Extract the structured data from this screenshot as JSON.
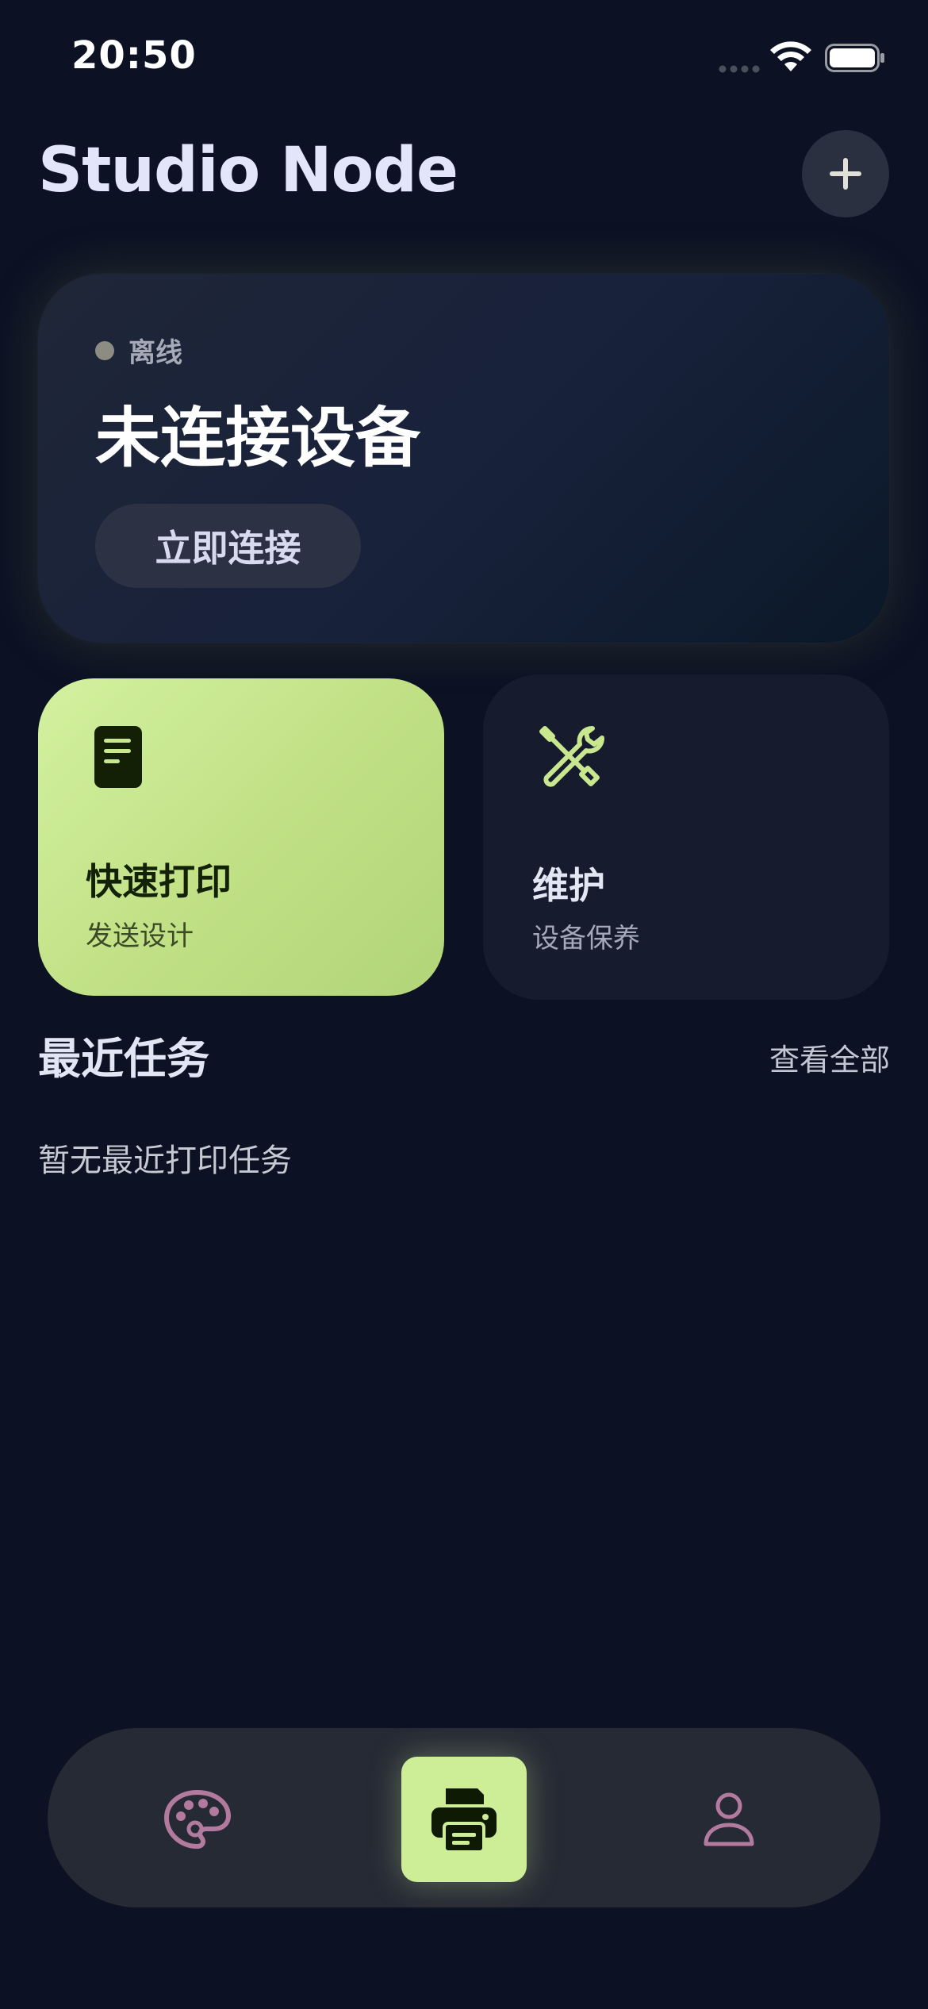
{
  "status_bar": {
    "time": "20:50"
  },
  "header": {
    "title": "Studio Node",
    "add_icon": "plus-icon"
  },
  "device_card": {
    "status_label": "离线",
    "status_color": "#8d8c82",
    "title": "未连接设备",
    "connect_label": "立即连接"
  },
  "actions": {
    "quick_print": {
      "title": "快速打印",
      "subtitle": "发送设计",
      "icon": "document-icon",
      "color": "#c8e78f"
    },
    "maintenance": {
      "title": "维护",
      "subtitle": "设备保养",
      "icon": "tools-icon"
    }
  },
  "recent": {
    "title": "最近任务",
    "view_all": "查看全部",
    "empty": "暂无最近打印任务"
  },
  "bottom_nav": {
    "items": [
      {
        "icon": "palette-icon",
        "active": false
      },
      {
        "icon": "printer-icon",
        "active": true
      },
      {
        "icon": "user-icon",
        "active": false
      }
    ],
    "accent": "#cdee96",
    "inactive_icon_color": "#b27a9e"
  }
}
